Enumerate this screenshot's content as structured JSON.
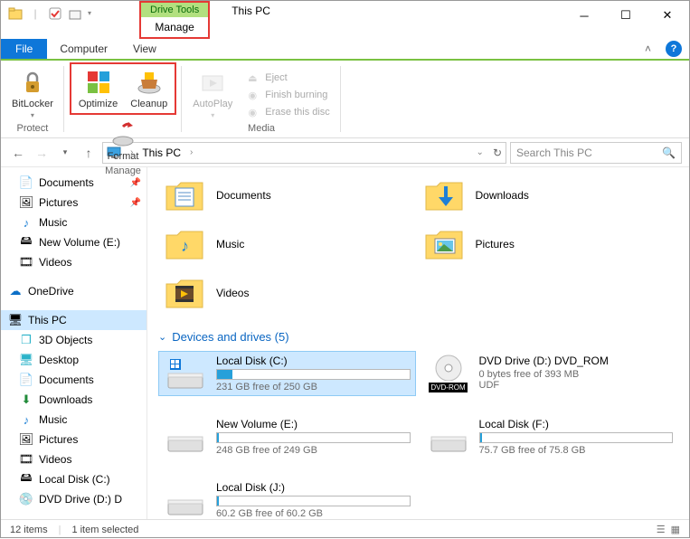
{
  "window": {
    "title": "This PC"
  },
  "qat": {
    "dropdown": "▾"
  },
  "tool_tabs": {
    "top": "Drive Tools",
    "bottom": "Manage"
  },
  "tabs": {
    "file": "File",
    "computer": "Computer",
    "view": "View"
  },
  "ribbon": {
    "protect": {
      "bitlocker": "BitLocker",
      "group": "Protect"
    },
    "manage": {
      "optimize": "Optimize",
      "cleanup": "Cleanup",
      "format": "Format",
      "group": "Manage"
    },
    "media": {
      "autoplay": "AutoPlay",
      "eject": "Eject",
      "finish": "Finish burning",
      "erase": "Erase this disc",
      "group": "Media"
    }
  },
  "addr": {
    "location": "This PC",
    "arrow": "›"
  },
  "search": {
    "placeholder": "Search This PC"
  },
  "nav": {
    "documents": "Documents",
    "pictures": "Pictures",
    "music": "Music",
    "newvol": "New Volume (E:)",
    "videos": "Videos",
    "onedrive": "OneDrive",
    "thispc": "This PC",
    "objects3d": "3D Objects",
    "desktop": "Desktop",
    "documents2": "Documents",
    "downloads": "Downloads",
    "music2": "Music",
    "pictures2": "Pictures",
    "videos2": "Videos",
    "localc": "Local Disk (C:)",
    "dvd": "DVD Drive (D:) D"
  },
  "folders": {
    "documents": "Documents",
    "downloads": "Downloads",
    "music": "Music",
    "pictures": "Pictures",
    "videos": "Videos"
  },
  "section": {
    "devices": "Devices and drives (5)"
  },
  "drives": {
    "c": {
      "name": "Local Disk (C:)",
      "free": "231 GB free of 250 GB",
      "pct": 8
    },
    "dvd": {
      "name": "DVD Drive (D:) DVD_ROM",
      "free": "0 bytes free of 393 MB",
      "udf": "UDF",
      "badge": "DVD-ROM"
    },
    "e": {
      "name": "New Volume (E:)",
      "free": "248 GB free of 249 GB",
      "pct": 1
    },
    "f": {
      "name": "Local Disk (F:)",
      "free": "75.7 GB free of 75.8 GB",
      "pct": 1
    },
    "j": {
      "name": "Local Disk (J:)",
      "free": "60.2 GB free of 60.2 GB",
      "pct": 1
    }
  },
  "status": {
    "items": "12 items",
    "selected": "1 item selected"
  }
}
